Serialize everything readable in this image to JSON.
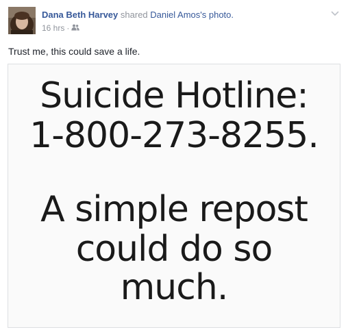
{
  "post": {
    "author": "Dana Beth Harvey",
    "action_text": "shared",
    "source_name": "Daniel Amos",
    "source_suffix": "'s photo.",
    "timestamp": "16 hrs",
    "separator": "·",
    "audience_icon": "friends-icon",
    "menu_icon": "chevron-down-icon",
    "status_text": "Trust me, this could save a life."
  },
  "photo": {
    "lines": [
      "Suicide Hotline:",
      "1-800-273-8255.",
      "A simple repost",
      "could do so",
      "much."
    ]
  },
  "colors": {
    "link": "#365899",
    "meta": "#90949c",
    "text": "#1d2129"
  }
}
